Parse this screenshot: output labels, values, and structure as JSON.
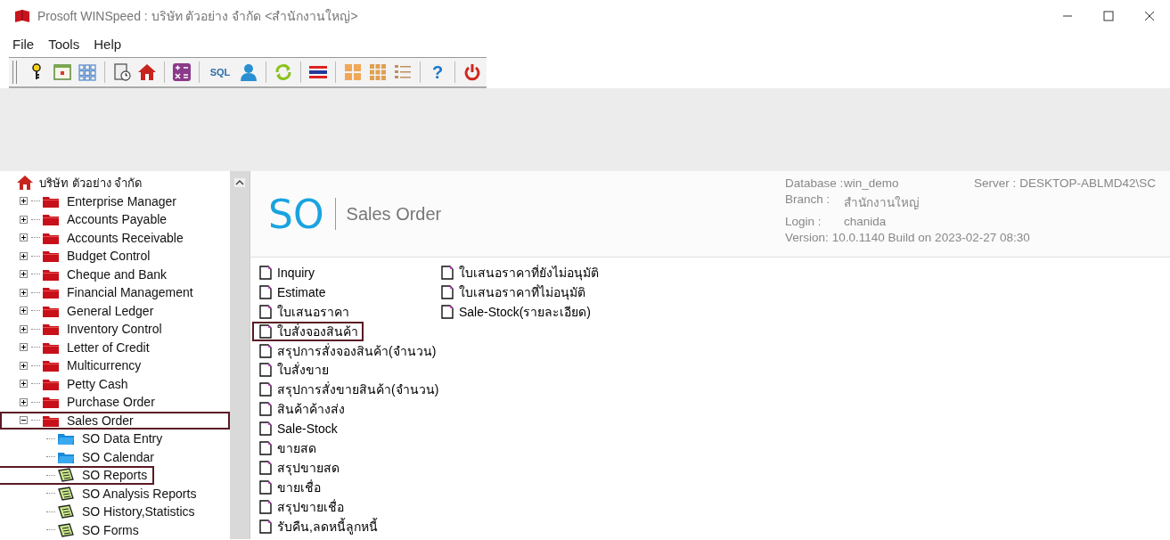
{
  "window": {
    "title": "Prosoft WINSpeed  :  บริษัท ตัวอย่าง จำกัด <สำนักงานใหญ่>"
  },
  "menu": [
    "File",
    "Tools",
    "Help"
  ],
  "toolbar": [
    {
      "kind": "key"
    },
    {
      "kind": "calendar"
    },
    {
      "kind": "grid"
    },
    {
      "kind": "sep"
    },
    {
      "kind": "clock-doc"
    },
    {
      "kind": "home"
    },
    {
      "kind": "sep"
    },
    {
      "kind": "calculator"
    },
    {
      "kind": "sep"
    },
    {
      "kind": "sql",
      "label": "SQL"
    },
    {
      "kind": "user"
    },
    {
      "kind": "sep"
    },
    {
      "kind": "refresh"
    },
    {
      "kind": "sep"
    },
    {
      "kind": "flag"
    },
    {
      "kind": "sep"
    },
    {
      "kind": "tiles-large"
    },
    {
      "kind": "tiles-small"
    },
    {
      "kind": "list"
    },
    {
      "kind": "sep"
    },
    {
      "kind": "help",
      "label": "?"
    },
    {
      "kind": "sep"
    },
    {
      "kind": "power"
    }
  ],
  "tree": {
    "label": "บริษัท ตัวอย่าง จำกัด",
    "children": [
      {
        "label": "Enterprise Manager",
        "kind": "folder",
        "expanded": false,
        "highlighted": false
      },
      {
        "label": "Accounts Payable",
        "kind": "folder",
        "expanded": false,
        "highlighted": false
      },
      {
        "label": "Accounts Receivable",
        "kind": "folder",
        "expanded": false,
        "highlighted": false
      },
      {
        "label": "Budget Control",
        "kind": "folder",
        "expanded": false,
        "highlighted": false
      },
      {
        "label": "Cheque and Bank",
        "kind": "folder",
        "expanded": false,
        "highlighted": false
      },
      {
        "label": "Financial Management",
        "kind": "folder",
        "expanded": false,
        "highlighted": false
      },
      {
        "label": "General Ledger",
        "kind": "folder",
        "expanded": false,
        "highlighted": false
      },
      {
        "label": "Inventory Control",
        "kind": "folder",
        "expanded": false,
        "highlighted": false
      },
      {
        "label": "Letter of Credit",
        "kind": "folder",
        "expanded": false,
        "highlighted": false
      },
      {
        "label": "Multicurrency",
        "kind": "folder",
        "expanded": false,
        "highlighted": false
      },
      {
        "label": "Petty Cash",
        "kind": "folder",
        "expanded": false,
        "highlighted": false
      },
      {
        "label": "Purchase Order",
        "kind": "folder",
        "expanded": false,
        "highlighted": false
      },
      {
        "label": "Sales Order",
        "kind": "folder",
        "expanded": true,
        "highlighted": true,
        "children": [
          {
            "label": "SO Data Entry",
            "kind": "entry",
            "highlighted": false
          },
          {
            "label": "SO Calendar",
            "kind": "entry",
            "highlighted": false
          },
          {
            "label": "SO Reports",
            "kind": "report",
            "highlighted": true
          },
          {
            "label": "SO Analysis Reports",
            "kind": "report",
            "highlighted": false
          },
          {
            "label": "SO History,Statistics",
            "kind": "report",
            "highlighted": false
          },
          {
            "label": "SO Forms",
            "kind": "report",
            "highlighted": false
          }
        ]
      }
    ]
  },
  "module": {
    "code": "SO",
    "name": "Sales Order"
  },
  "info": [
    {
      "label": "Database :",
      "value": "win_demo"
    },
    {
      "label": "Server :",
      "value": "DESKTOP-ABLMD42\\SC"
    },
    {
      "label": "Branch :",
      "value": "สำนักงานใหญ่"
    },
    {
      "label": "Login :",
      "value": "chanida"
    },
    {
      "label": "Version:",
      "value": "10.0.1140  Build on 2023-02-27 08:30"
    }
  ],
  "reports": [
    [
      {
        "label": "Inquiry",
        "highlighted": false
      },
      {
        "label": "Estimate",
        "highlighted": false
      },
      {
        "label": "ใบเสนอราคา",
        "highlighted": false
      },
      {
        "label": "ใบสั่งจองสินค้า",
        "highlighted": true
      },
      {
        "label": "สรุปการสั่งจองสินค้า(จำนวน)",
        "highlighted": false
      },
      {
        "label": "ใบสั่งขาย",
        "highlighted": false
      },
      {
        "label": "สรุปการสั่งขายสินค้า(จำนวน)",
        "highlighted": false
      },
      {
        "label": "สินค้าค้างส่ง",
        "highlighted": false
      },
      {
        "label": "Sale-Stock",
        "highlighted": false
      },
      {
        "label": "ขายสด",
        "highlighted": false
      },
      {
        "label": "สรุปขายสด",
        "highlighted": false
      },
      {
        "label": "ขายเชื่อ",
        "highlighted": false
      },
      {
        "label": "สรุปขายเชื่อ",
        "highlighted": false
      },
      {
        "label": "รับคืน,ลดหนี้ลูกหนี้",
        "highlighted": false
      }
    ],
    [
      {
        "label": "ใบเสนอราคาที่ยังไม่อนุมัติ",
        "highlighted": false
      },
      {
        "label": "ใบเสนอราคาที่ไม่อนุมัติ",
        "highlighted": false
      },
      {
        "label": "Sale-Stock(รายละเอียด)",
        "highlighted": false
      }
    ]
  ]
}
